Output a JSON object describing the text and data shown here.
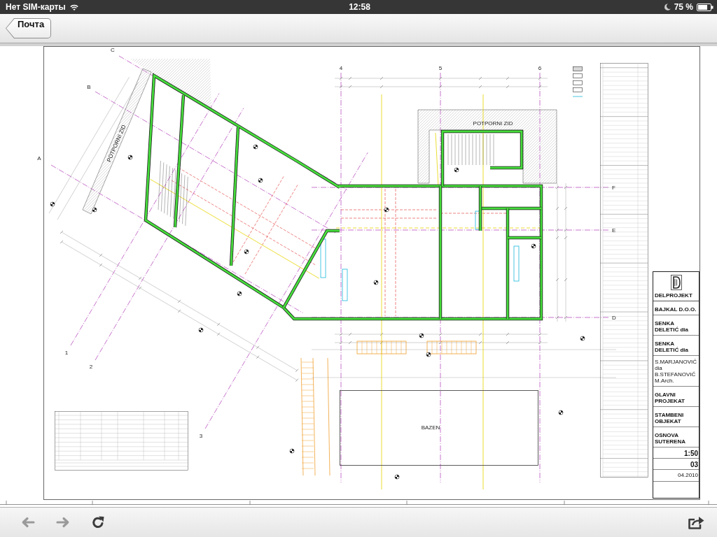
{
  "status_bar": {
    "carrier": "Нет SIM-карты",
    "time": "12:58",
    "battery": "75 %"
  },
  "nav_bar": {
    "back_button": "Почта"
  },
  "document": {
    "grid_columns": [
      "4",
      "5",
      "6"
    ],
    "grid_rows": [
      "F",
      "E",
      "D"
    ],
    "skewed_grid_rows": [
      "C",
      "B",
      "A"
    ],
    "skewed_grid_columns": [
      "1",
      "2",
      "3"
    ],
    "wall_labels": [
      "POTPORNI ZID",
      "POTPORNI ZID"
    ],
    "pool_label": "BAZEN",
    "title_block": {
      "company": "DELPROJEKT",
      "fields": [
        {
          "kind": "text",
          "value": "BAJKAL D.O.O."
        },
        {
          "kind": "text",
          "value": "SENKA DELETIĆ dia"
        },
        {
          "kind": "text",
          "value": "SENKA DELETIĆ dia"
        },
        {
          "kind": "note",
          "value": "S.MARJANOVIĆ dia B.STEFANOVIĆ M.Arch."
        },
        {
          "kind": "text",
          "value": "GLAVNI PROJEKAT"
        },
        {
          "kind": "text",
          "value": "STAMBENI OBJEKAT"
        },
        {
          "kind": "text",
          "value": "OSNOVA SUTERENA"
        },
        {
          "kind": "number",
          "value": "1:50"
        },
        {
          "kind": "number",
          "value": "03"
        },
        {
          "kind": "date",
          "value": "04.2010"
        }
      ]
    }
  },
  "toolbar": {
    "buttons": [
      {
        "kind": "back",
        "disabled": true
      },
      {
        "kind": "forward",
        "disabled": true
      },
      {
        "kind": "reload",
        "disabled": false
      },
      {
        "kind": "share",
        "disabled": false
      }
    ]
  }
}
